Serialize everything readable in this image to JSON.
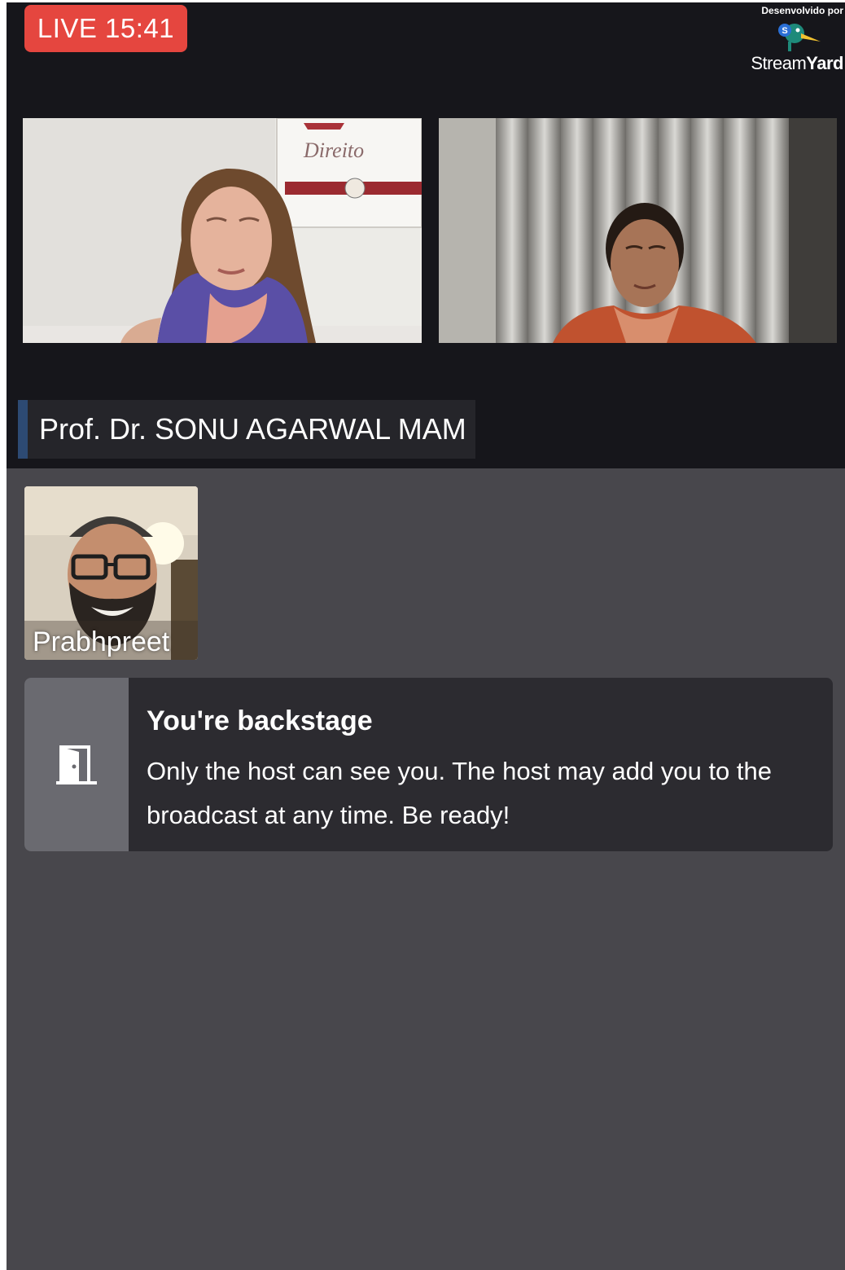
{
  "live_badge": "LIVE 15:41",
  "branding": {
    "caption": "Desenvolvido por",
    "name_light": "Stream",
    "name_bold": "Yard"
  },
  "video_tiles": [
    {
      "poster_text": "Direito"
    },
    {
      "poster_text": ""
    }
  ],
  "speaker_name_tag": "Prof. Dr. SONU AGARWAL MAM",
  "backstage_participant": {
    "name": "Prabhpreet"
  },
  "backstage_notice": {
    "icon": "door-icon",
    "title": "You're backstage",
    "message": "Only the host can see you. The host may add you to the broadcast at any time. Be ready!"
  },
  "colors": {
    "live_red": "#e5463f",
    "stage_bg": "#16161b",
    "backstage_bg": "#48474c",
    "name_tag_accent": "#2d4a73"
  }
}
